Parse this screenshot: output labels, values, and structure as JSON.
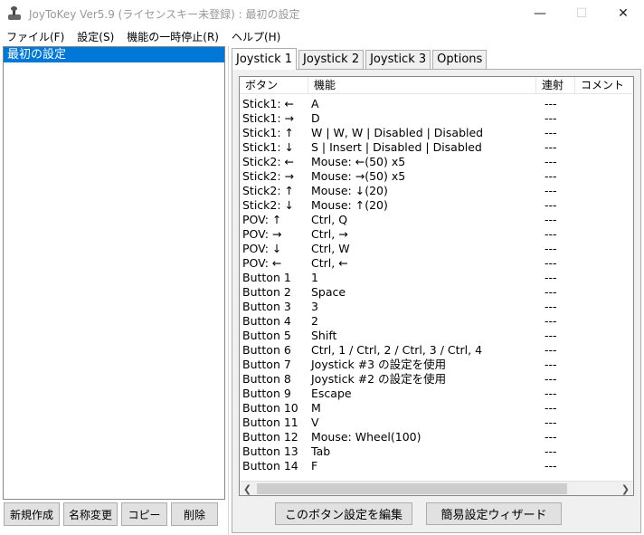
{
  "window": {
    "title": "JoyToKey Ver5.9 (ライセンスキー未登録) : 最初の設定",
    "minimize_icon": "—",
    "maximize_icon": "☐",
    "close_icon": "✕"
  },
  "menu": [
    "ファイル(F)",
    "設定(S)",
    "機能の一時停止(R)",
    "ヘルプ(H)"
  ],
  "configs": [
    "最初の設定"
  ],
  "left_buttons": [
    "新規作成",
    "名称変更",
    "コピー",
    "削除"
  ],
  "tabs": [
    "Joystick 1",
    "Joystick 2",
    "Joystick 3",
    "Options"
  ],
  "columns": [
    "ボタン",
    "機能",
    "連射",
    "コメント"
  ],
  "rows": [
    {
      "button": "Stick1: ←",
      "function": "A",
      "rapid": "---"
    },
    {
      "button": "Stick1: →",
      "function": "D",
      "rapid": "---"
    },
    {
      "button": "Stick1: ↑",
      "function": "W | W, W | Disabled | Disabled",
      "rapid": "---"
    },
    {
      "button": "Stick1: ↓",
      "function": "S | Insert | Disabled | Disabled",
      "rapid": "---"
    },
    {
      "button": "Stick2: ←",
      "function": "Mouse: ←(50) x5",
      "rapid": "---"
    },
    {
      "button": "Stick2: →",
      "function": "Mouse: →(50) x5",
      "rapid": "---"
    },
    {
      "button": "Stick2: ↑",
      "function": "Mouse: ↓(20)",
      "rapid": "---"
    },
    {
      "button": "Stick2: ↓",
      "function": "Mouse: ↑(20)",
      "rapid": "---"
    },
    {
      "button": "POV: ↑",
      "function": "Ctrl, Q",
      "rapid": "---"
    },
    {
      "button": "POV: →",
      "function": "Ctrl, →",
      "rapid": "---"
    },
    {
      "button": "POV: ↓",
      "function": "Ctrl, W",
      "rapid": "---"
    },
    {
      "button": "POV: ←",
      "function": "Ctrl, ←",
      "rapid": "---"
    },
    {
      "button": "Button 1",
      "function": "1",
      "rapid": "---"
    },
    {
      "button": "Button 2",
      "function": "Space",
      "rapid": "---"
    },
    {
      "button": "Button 3",
      "function": "3",
      "rapid": "---"
    },
    {
      "button": "Button 4",
      "function": "2",
      "rapid": "---"
    },
    {
      "button": "Button 5",
      "function": "Shift",
      "rapid": "---"
    },
    {
      "button": "Button 6",
      "function": "Ctrl, 1 / Ctrl, 2 / Ctrl, 3 / Ctrl, 4",
      "rapid": "---"
    },
    {
      "button": "Button 7",
      "function": "Joystick #3 の設定を使用",
      "rapid": "---"
    },
    {
      "button": "Button 8",
      "function": "Joystick #2 の設定を使用",
      "rapid": "---"
    },
    {
      "button": "Button 9",
      "function": "Escape",
      "rapid": "---"
    },
    {
      "button": "Button 10",
      "function": "M",
      "rapid": "---"
    },
    {
      "button": "Button 11",
      "function": "V",
      "rapid": "---"
    },
    {
      "button": "Button 12",
      "function": "Mouse: Wheel(100)",
      "rapid": "---"
    },
    {
      "button": "Button 13",
      "function": "Tab",
      "rapid": "---"
    },
    {
      "button": "Button 14",
      "function": "F",
      "rapid": "---"
    }
  ],
  "bottom_buttons": [
    "このボタン設定を編集",
    "簡易設定ウィザード"
  ],
  "colors": {
    "selection": "#0078d7"
  }
}
